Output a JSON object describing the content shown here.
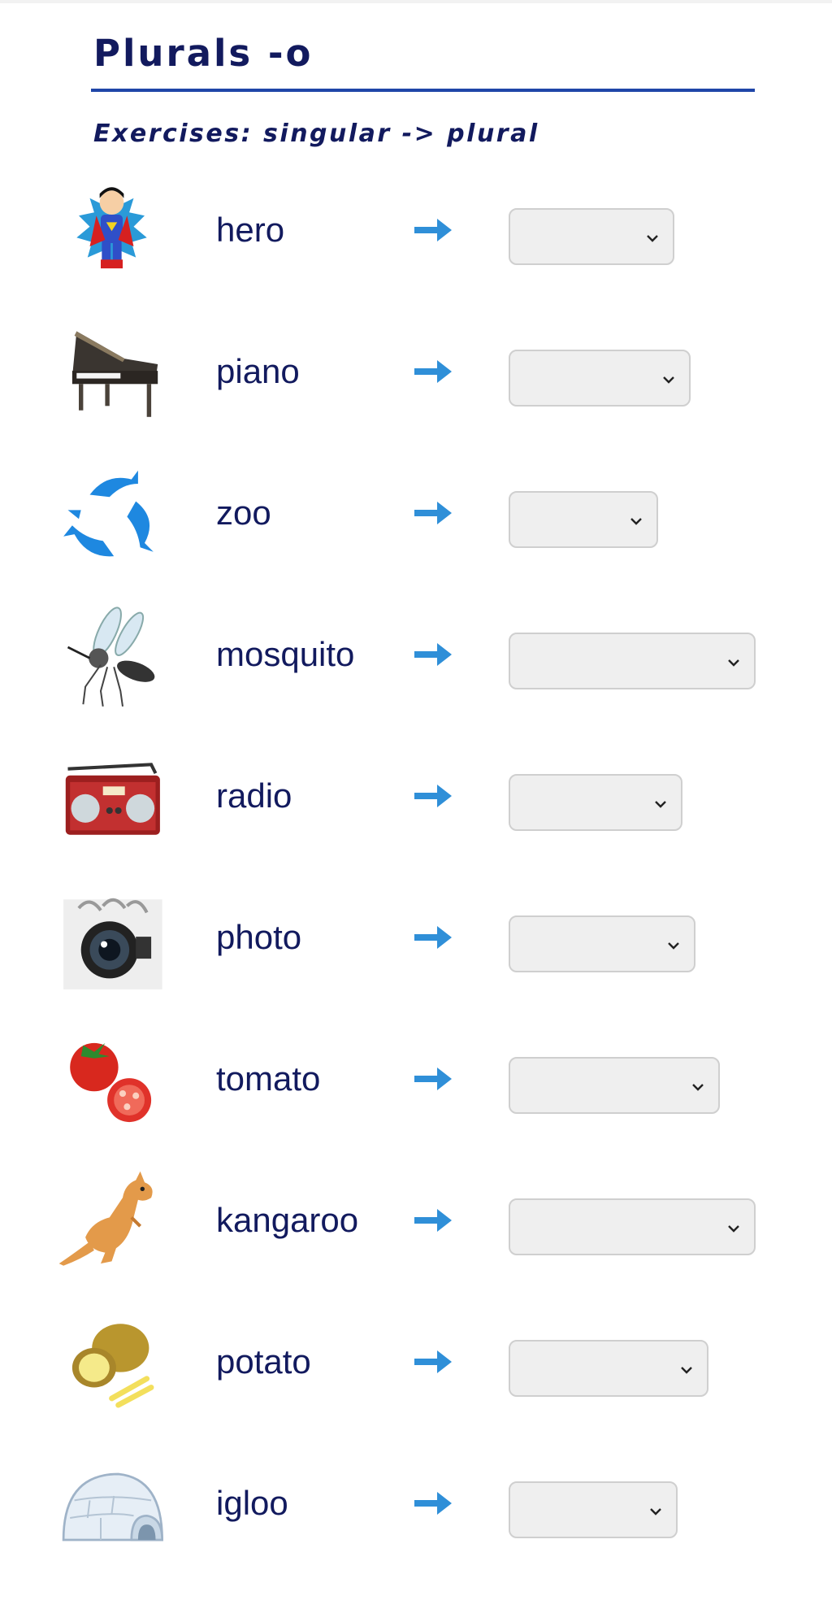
{
  "page": {
    "title": "Plurals -o",
    "subtitle": "Exercises: singular -> plural"
  },
  "exercises": [
    {
      "word": "hero",
      "icon": "superhero-icon",
      "answer": ""
    },
    {
      "word": "piano",
      "icon": "piano-icon",
      "answer": ""
    },
    {
      "word": "zoo",
      "icon": "dolphins-icon",
      "answer": ""
    },
    {
      "word": "mosquito",
      "icon": "mosquito-icon",
      "answer": ""
    },
    {
      "word": "radio",
      "icon": "radio-icon",
      "answer": ""
    },
    {
      "word": "photo",
      "icon": "camera-icon",
      "answer": ""
    },
    {
      "word": "tomato",
      "icon": "tomato-icon",
      "answer": ""
    },
    {
      "word": "kangaroo",
      "icon": "kangaroo-icon",
      "answer": ""
    },
    {
      "word": "potato",
      "icon": "potato-icon",
      "answer": ""
    },
    {
      "word": "igloo",
      "icon": "igloo-icon",
      "answer": ""
    }
  ],
  "colors": {
    "title": "#121a5e",
    "rule": "#1f46a8",
    "arrow": "#2f8fd8",
    "dropdown_bg": "#efefef",
    "dropdown_border": "#cfcfcf"
  }
}
